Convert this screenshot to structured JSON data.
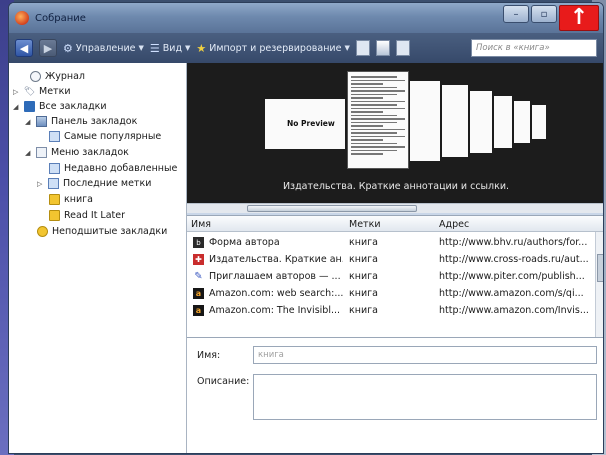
{
  "window": {
    "title": "Собрание",
    "close_glyph": "↑"
  },
  "toolbar": {
    "back_glyph": "◀",
    "forward_glyph": "▶",
    "manage_label": "Управление",
    "views_label": "Вид",
    "import_label": "Импорт и резервирование",
    "search_placeholder": "Поиск в «книга»"
  },
  "sidebar": {
    "items": [
      {
        "label": "Журнал",
        "icon": "clock-icon"
      },
      {
        "label": "Метки",
        "icon": "tag-icon"
      },
      {
        "label": "Все закладки",
        "icon": "bookmarks-icon"
      },
      {
        "label": "Панель закладок",
        "icon": "toolbar-icon"
      },
      {
        "label": "Самые популярные",
        "icon": "smart-query-icon"
      },
      {
        "label": "Меню закладок",
        "icon": "menu-icon"
      },
      {
        "label": "Недавно добавленные",
        "icon": "smart-query-icon"
      },
      {
        "label": "Последние метки",
        "icon": "smart-query-icon"
      },
      {
        "label": "книга",
        "icon": "folder-icon"
      },
      {
        "label": "Read It Later",
        "icon": "folder-icon"
      },
      {
        "label": "Неподшитые закладки",
        "icon": "unsorted-icon"
      }
    ]
  },
  "preview": {
    "no_preview_text": "No Preview",
    "caption": "Издательства. Краткие аннотации и ссылки."
  },
  "table": {
    "headers": {
      "name": "Имя",
      "tags": "Метки",
      "address": "Адрес"
    },
    "rows": [
      {
        "name": "Форма автора",
        "tags": "книга",
        "address": "http://www.bhv.ru/authors/for...",
        "icon": "bhv-favicon"
      },
      {
        "name": "Издательства. Краткие ан...",
        "tags": "книга",
        "address": "http://www.cross-roads.ru/aut...",
        "icon": "cross-roads-favicon"
      },
      {
        "name": "Приглашаем авторов — ...",
        "tags": "книга",
        "address": "http://www.piter.com/publish...",
        "icon": "piter-favicon"
      },
      {
        "name": "Amazon.com: web search:...",
        "tags": "книга",
        "address": "http://www.amazon.com/s/qi...",
        "icon": "amazon-favicon"
      },
      {
        "name": "Amazon.com: The Invisibl...",
        "tags": "книга",
        "address": "http://www.amazon.com/Invis...",
        "icon": "amazon-favicon"
      }
    ]
  },
  "details": {
    "name_label": "Имя:",
    "name_value": "книга",
    "description_label": "Описание:",
    "description_value": ""
  }
}
